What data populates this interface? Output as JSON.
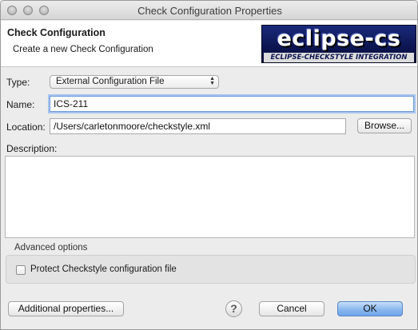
{
  "window": {
    "title": "Check Configuration Properties"
  },
  "header": {
    "title": "Check Configuration",
    "description": "Create a new Check Configuration",
    "logo_main": "eclipse-cs",
    "logo_sub": "ECLIPSE-CHECKSTYLE INTEGRATION"
  },
  "form": {
    "type_label": "Type:",
    "type_value": "External Configuration File",
    "name_label": "Name:",
    "name_value": "ICS-211",
    "location_label": "Location:",
    "location_value": "/Users/carletonmoore/checkstyle.xml",
    "browse_label": "Browse...",
    "description_label": "Description:",
    "description_value": ""
  },
  "advanced": {
    "title": "Advanced options",
    "protect_label": "Protect Checkstyle configuration file",
    "protect_checked": false
  },
  "footer": {
    "additional_label": "Additional properties...",
    "help_symbol": "?",
    "cancel_label": "Cancel",
    "ok_label": "OK"
  }
}
